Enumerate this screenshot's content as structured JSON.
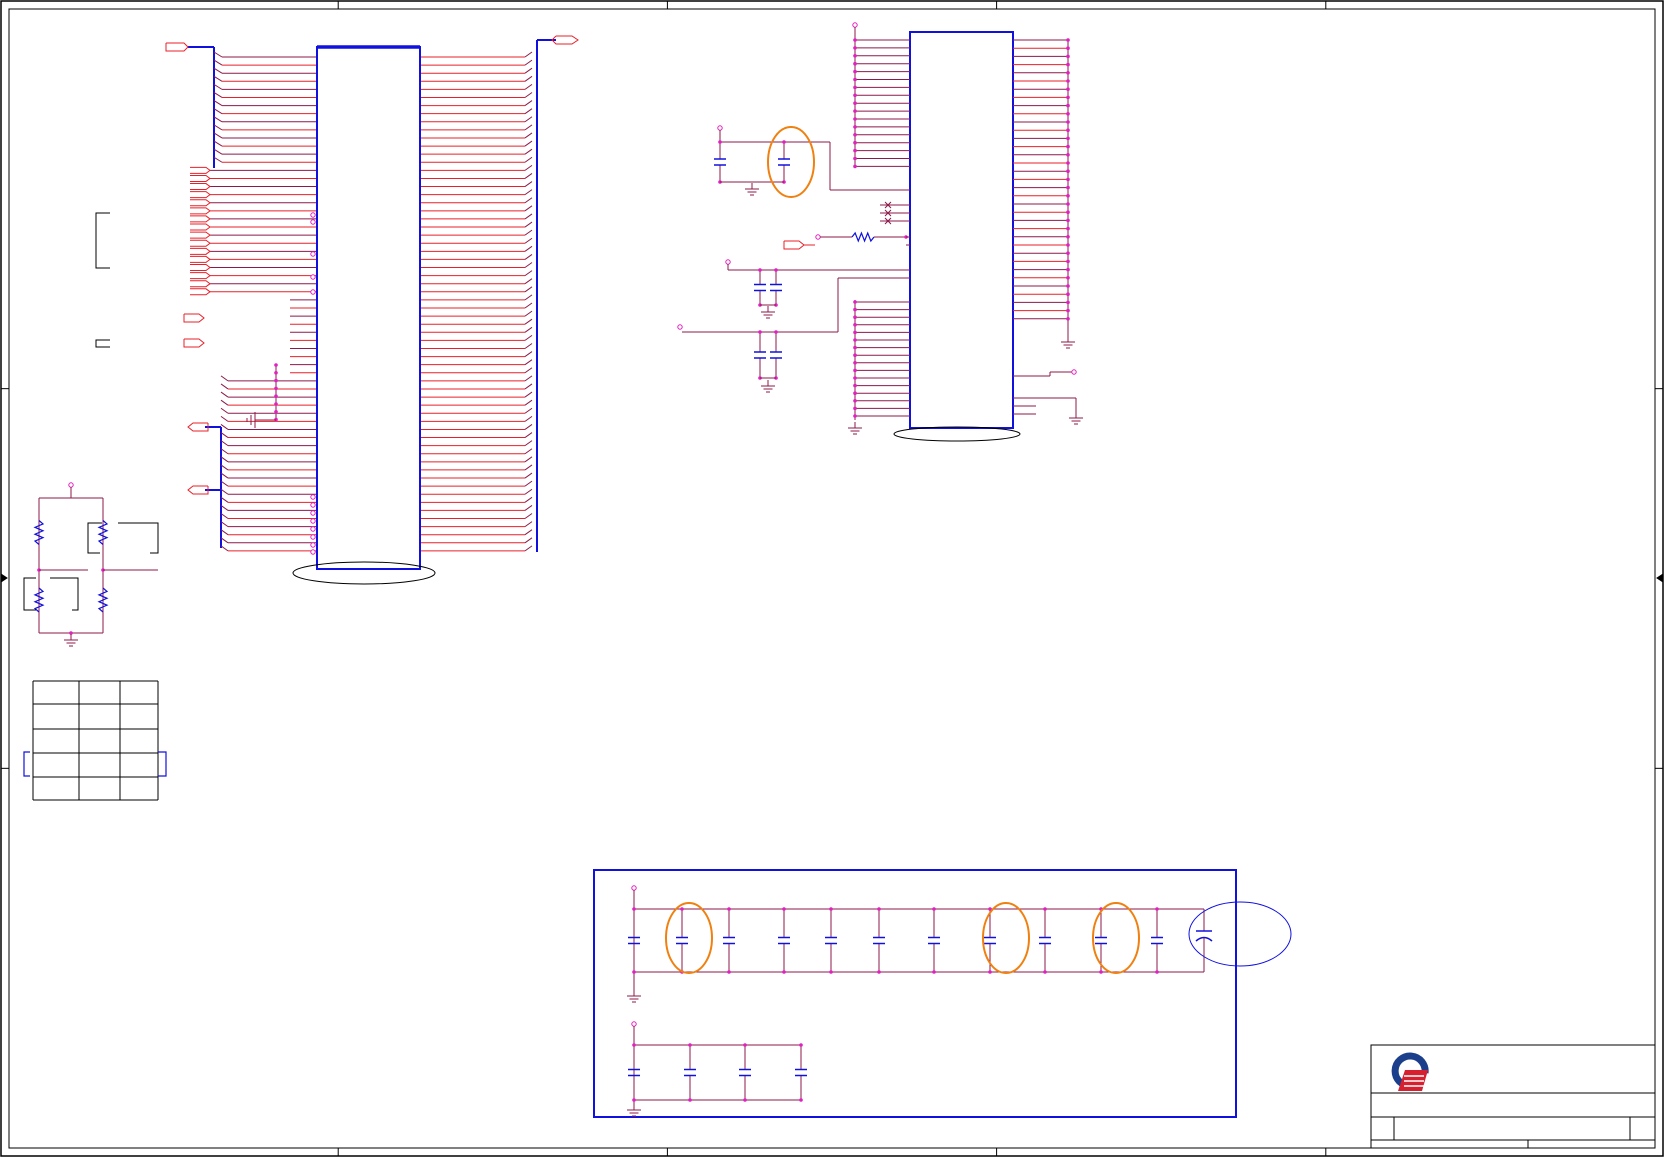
{
  "sheet": {
    "border_color": "#000000",
    "wire_color": "#e8202a",
    "net_color": "#8b1a4a",
    "part_color": "#1010e0",
    "junction_color": "#e020c0",
    "highlight_color": "#f08010",
    "logo_colors": {
      "blue": "#1b3f8b",
      "red": "#d62030"
    }
  },
  "zones": {
    "top_marks": 5,
    "side_marks": 3
  },
  "title_block": {
    "logo": "company-logo-icon"
  }
}
